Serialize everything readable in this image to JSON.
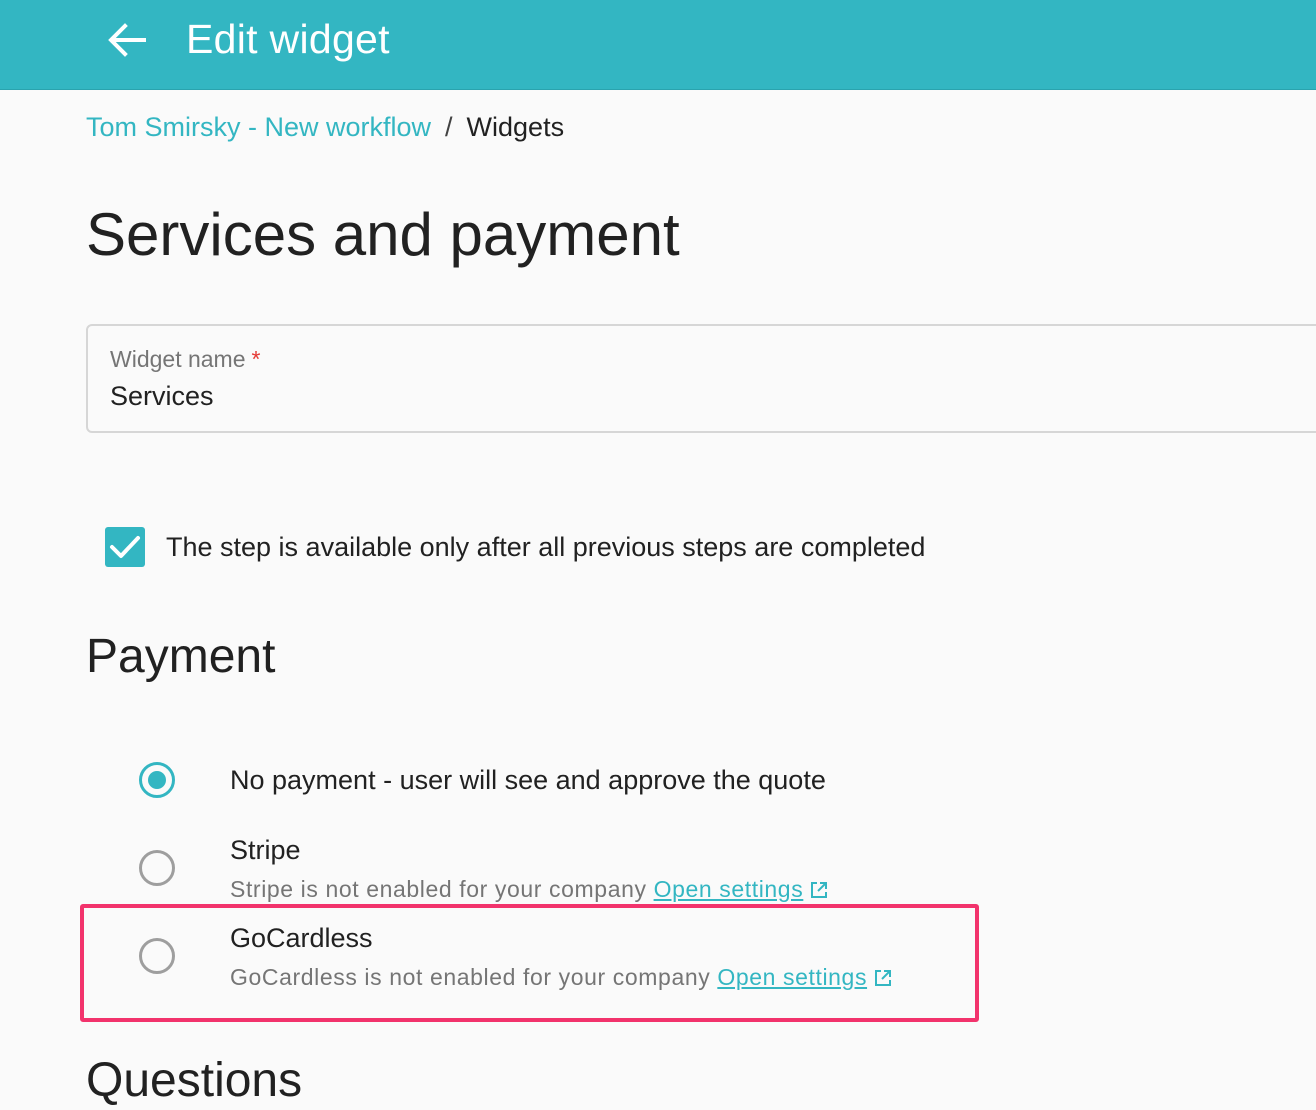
{
  "header": {
    "title": "Edit widget",
    "background": "#33b6c2"
  },
  "breadcrumb": {
    "parent": "Tom Smirsky - New workflow",
    "separator": "/",
    "current": "Widgets"
  },
  "page": {
    "title": "Services and payment"
  },
  "widget_name_field": {
    "label": "Widget name",
    "required_marker": "*",
    "value": "Services"
  },
  "step_checkbox": {
    "checked": true,
    "label": "The step is available only after all previous steps are completed"
  },
  "payment": {
    "section_title": "Payment",
    "options": [
      {
        "label": "No payment - user will see and approve the quote",
        "selected": true
      },
      {
        "label": "Stripe",
        "selected": false,
        "status_text": "Stripe is not enabled for your company",
        "link_label": "Open settings"
      },
      {
        "label": "GoCardless",
        "selected": false,
        "status_text": "GoCardless is not enabled for your company",
        "link_label": "Open settings"
      }
    ]
  },
  "next_section": {
    "title": "Questions"
  },
  "colors": {
    "accent": "#33b6c2",
    "highlight": "#f2336c",
    "required": "#e53935"
  }
}
